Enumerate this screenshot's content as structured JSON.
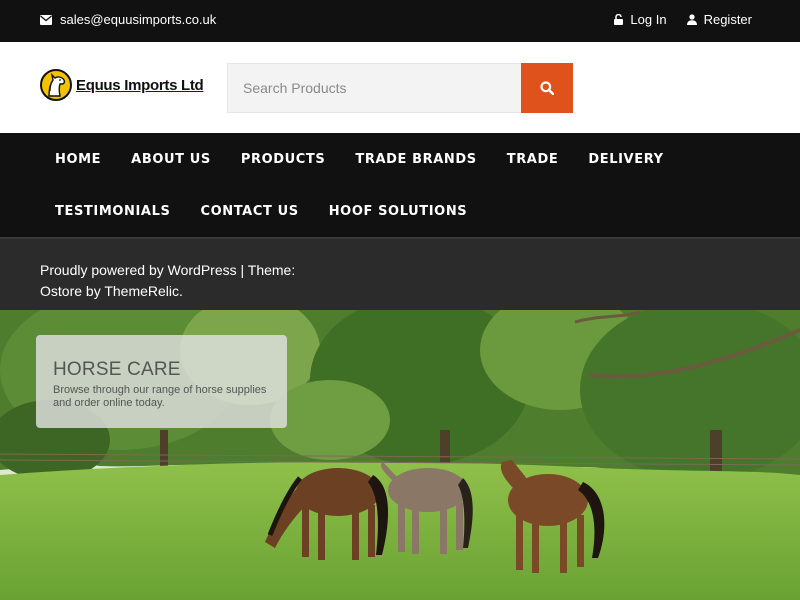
{
  "topbar": {
    "email": "sales@equusimports.co.uk",
    "login_label": "Log In",
    "register_label": "Register"
  },
  "header": {
    "logo_text": "Equus Imports Ltd",
    "search": {
      "placeholder": "Search Products",
      "value": ""
    }
  },
  "nav": {
    "items": [
      "HOME",
      "ABOUT US",
      "PRODUCTS",
      "TRADE BRANDS",
      "TRADE",
      "DELIVERY",
      "TESTIMONIALS",
      "CONTACT US",
      "HOOF SOLUTIONS"
    ]
  },
  "credit": {
    "text": "Proudly powered by WordPress | Theme: Ostore by ThemeRelic."
  },
  "hero": {
    "title": "HORSE CARE",
    "subtitle": "Browse through our range of horse supplies and order online today."
  },
  "colors": {
    "topbar_bg": "#111111",
    "accent": "#e0521c",
    "credit_bg": "#2b2b2b"
  },
  "icons": {
    "email": "envelope-icon",
    "login": "lock-icon",
    "register": "user-icon",
    "search": "search-icon"
  }
}
